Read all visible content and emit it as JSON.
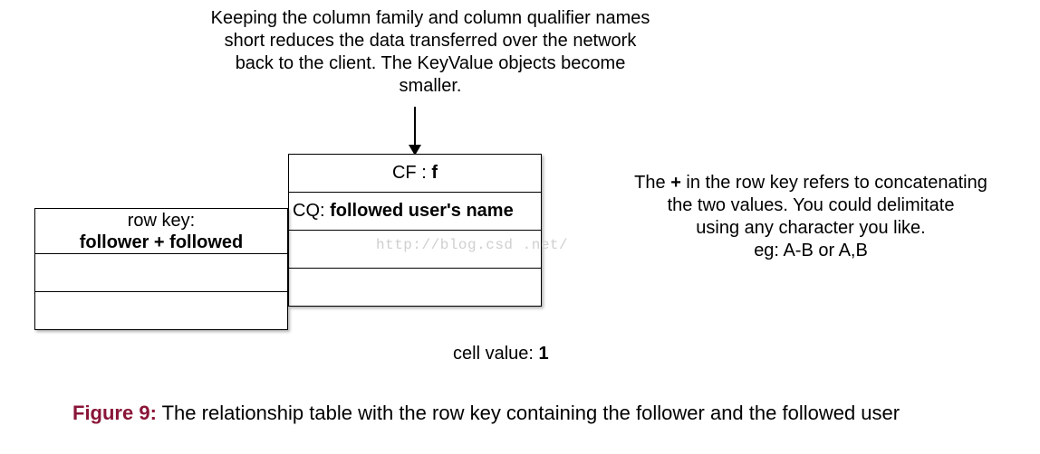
{
  "top_annotation": "Keeping the column family and column qualifier names short reduces the data transferred over the network back to the client. The KeyValue objects become smaller.",
  "table": {
    "cf_label_prefix": "CF : ",
    "cf_value": "f",
    "cq_label_prefix": "CQ: ",
    "cq_value": "followed user's name",
    "rowkey_label": "row key:",
    "rowkey_value": "follower + followed"
  },
  "watermark": "http://blog.csd .net/",
  "right_annotation": {
    "line1_pre": "The ",
    "line1_bold": "+",
    "line1_post": " in the row key refers to concatenating",
    "line2": "the two values. You could delimitate",
    "line3": "using any character you like.",
    "line4": "eg: A-B or A,B"
  },
  "cell_value_label": "cell value: ",
  "cell_value": "1",
  "figure": {
    "number": "Figure 9:",
    "caption": " The relationship table with the row key containing the follower and the followed user"
  }
}
